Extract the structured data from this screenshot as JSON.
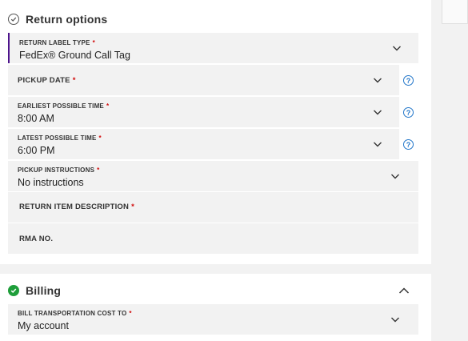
{
  "return_options": {
    "title": "Return options",
    "fields": [
      {
        "label": "RETURN LABEL TYPE",
        "value": "FedEx® Ground Call Tag",
        "required": "*"
      },
      {
        "label": "PICKUP DATE",
        "value": "",
        "required": "*"
      },
      {
        "label": "EARLIEST POSSIBLE TIME",
        "value": "8:00 AM",
        "required": "*"
      },
      {
        "label": "LATEST POSSIBLE TIME",
        "value": "6:00 PM",
        "required": "*"
      },
      {
        "label": "PICKUP INSTRUCTIONS",
        "value": "No instructions",
        "required": "*"
      },
      {
        "label": "RETURN ITEM DESCRIPTION",
        "value": "",
        "required": "*"
      },
      {
        "label": "RMA NO.",
        "value": ""
      }
    ],
    "help_glyph": "?"
  },
  "billing": {
    "title": "Billing",
    "fields": [
      {
        "label": "BILL TRANSPORTATION COST TO",
        "value": "My account",
        "required": "*"
      }
    ]
  },
  "icons": {
    "section_check": "circle-check-icon",
    "billing_check": "check-filled-icon",
    "dropdown": "chevron-down-icon",
    "collapse": "chevron-up-icon",
    "help": "help-icon"
  },
  "colors": {
    "accent_purple": "#4d148c",
    "required_red": "#d10a0a",
    "help_blue": "#2276c9",
    "success_green": "#1e9e3a"
  }
}
